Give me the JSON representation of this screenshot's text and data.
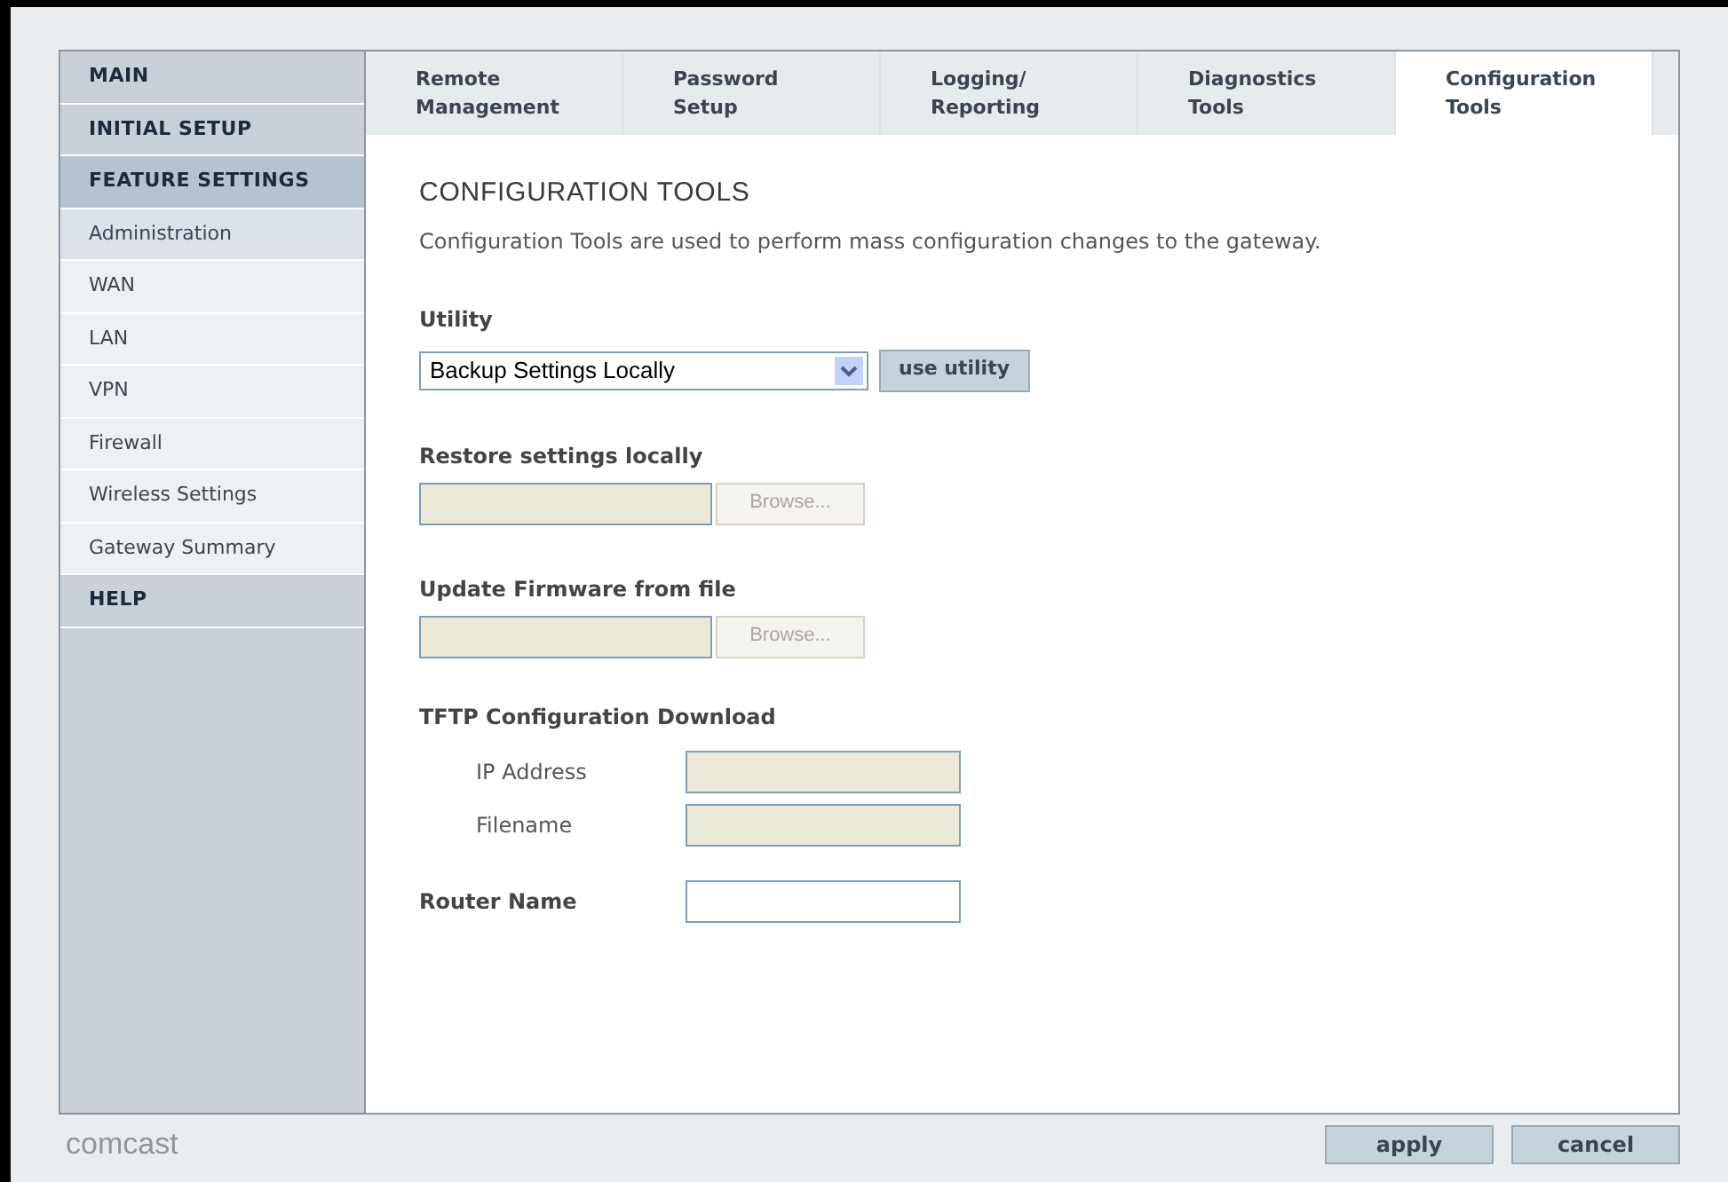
{
  "sidebar": {
    "items": [
      {
        "label": "MAIN",
        "kind": "header",
        "selected": false
      },
      {
        "label": "INITIAL SETUP",
        "kind": "header",
        "selected": false
      },
      {
        "label": "FEATURE SETTINGS",
        "kind": "header",
        "selected": true
      },
      {
        "label": "Administration",
        "kind": "link",
        "selected": true
      },
      {
        "label": "WAN",
        "kind": "link",
        "selected": false
      },
      {
        "label": "LAN",
        "kind": "link",
        "selected": false
      },
      {
        "label": "VPN",
        "kind": "link",
        "selected": false
      },
      {
        "label": "Firewall",
        "kind": "link",
        "selected": false
      },
      {
        "label": "Wireless Settings",
        "kind": "link",
        "selected": false
      },
      {
        "label": "Gateway Summary",
        "kind": "link",
        "selected": false
      },
      {
        "label": "HELP",
        "kind": "header",
        "selected": false
      }
    ]
  },
  "tabs": [
    {
      "label": "Remote Management",
      "selected": false
    },
    {
      "label": "Password Setup",
      "selected": false
    },
    {
      "label": "Logging/ Reporting",
      "selected": false
    },
    {
      "label": "Diagnostics Tools",
      "selected": false
    },
    {
      "label": "Configuration Tools",
      "selected": true
    }
  ],
  "content": {
    "title": "CONFIGURATION TOOLS",
    "description": "Configuration Tools are used to perform mass configuration changes to the gateway.",
    "utility": {
      "label": "Utility",
      "value": "Backup Settings Locally",
      "button": "use utility"
    },
    "file_sections": [
      {
        "label": "Restore settings locally",
        "button": "Browse...",
        "disabled": true
      },
      {
        "label": "Update Firmware from file",
        "button": "Browse...",
        "disabled": true
      }
    ],
    "tftp": {
      "label": "TFTP Configuration Download",
      "fields": [
        {
          "label": "IP Address",
          "disabled": true
        },
        {
          "label": "Filename",
          "disabled": true
        }
      ]
    },
    "router_name": {
      "label": "Router Name",
      "disabled": false
    }
  },
  "footer": {
    "logo": "comcast",
    "buttons": [
      "apply",
      "cancel"
    ]
  }
}
